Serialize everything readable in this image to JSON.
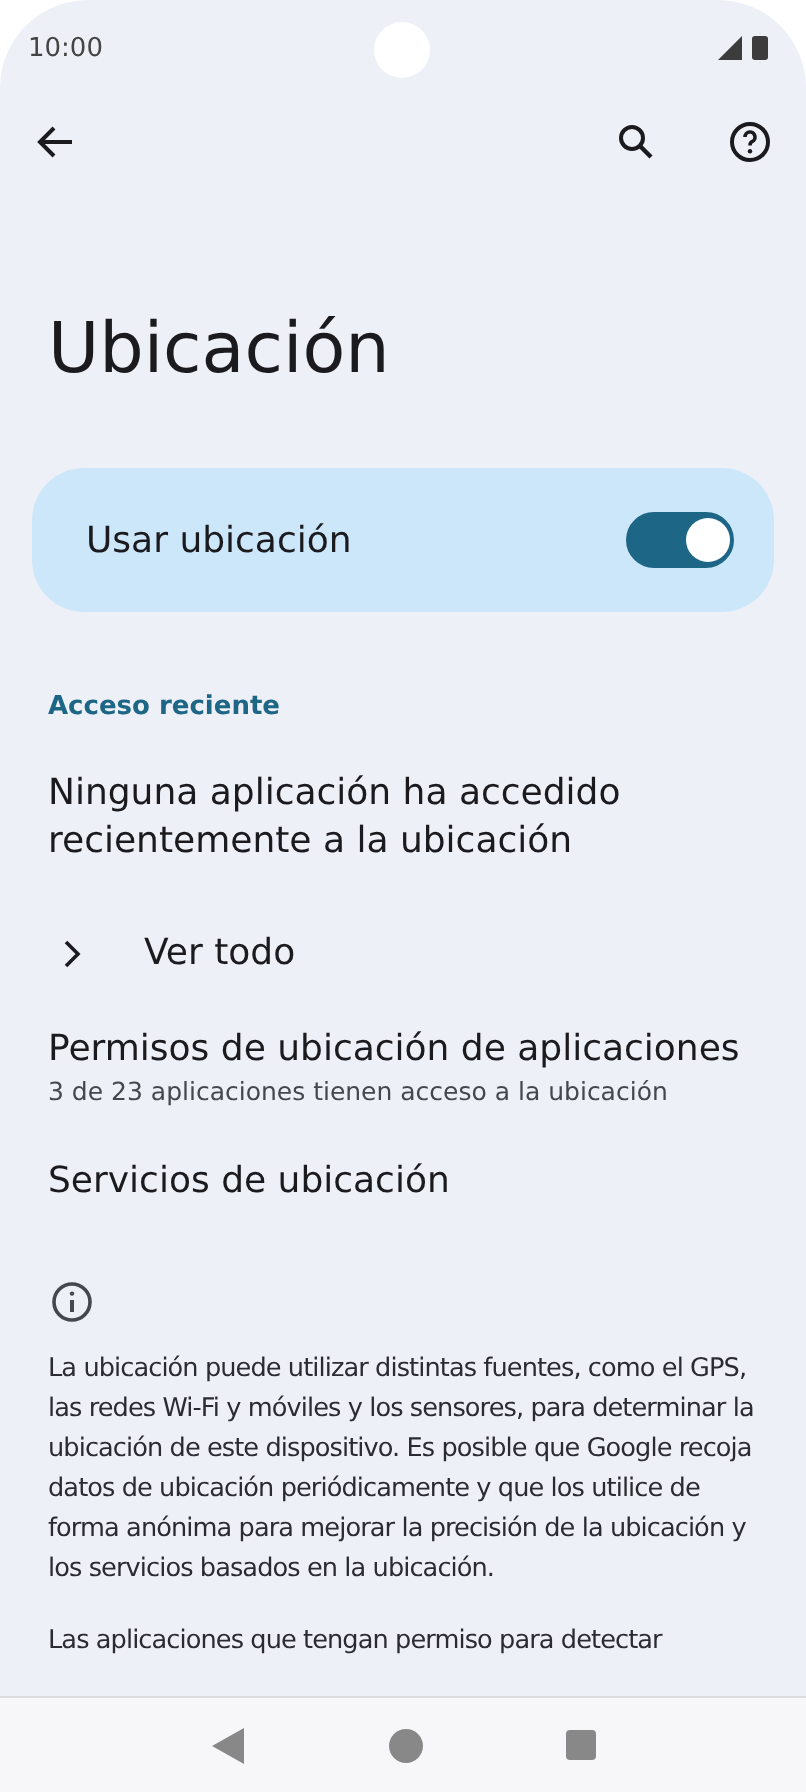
{
  "status_bar": {
    "time": "10:00"
  },
  "toolbar": {
    "actions": [
      {
        "kind": "search"
      },
      {
        "kind": "help"
      }
    ]
  },
  "title": "Ubicación",
  "main_switch": {
    "label": "Usar ubicación",
    "on": true
  },
  "section_header": "Acceso reciente",
  "items": [
    {
      "kind": "text",
      "title": "Ninguna aplicación ha accedido recientemente a la ubicación"
    },
    {
      "kind": "expand",
      "title": "Ver todo"
    },
    {
      "kind": "text",
      "title": "Permisos de ubicación de aplicaciones",
      "subtitle": "3 de 23 aplicaciones tienen acceso a la ubicación"
    },
    {
      "kind": "text",
      "title": "Servicios de ubicación"
    }
  ],
  "footer": {
    "paragraphs": [
      "La ubicación puede utilizar distintas fuentes, como el GPS, las redes Wi-Fi y móviles y los sensores, para determinar la ubicación de este dispositivo. Es posible que Google recoja datos de ubicación periódicamente y que los utilice de forma anónima para mejorar la precisión de la ubicación y los servicios basados en la ubicación.",
      "Las aplicaciones que tengan permiso para detectar"
    ]
  }
}
